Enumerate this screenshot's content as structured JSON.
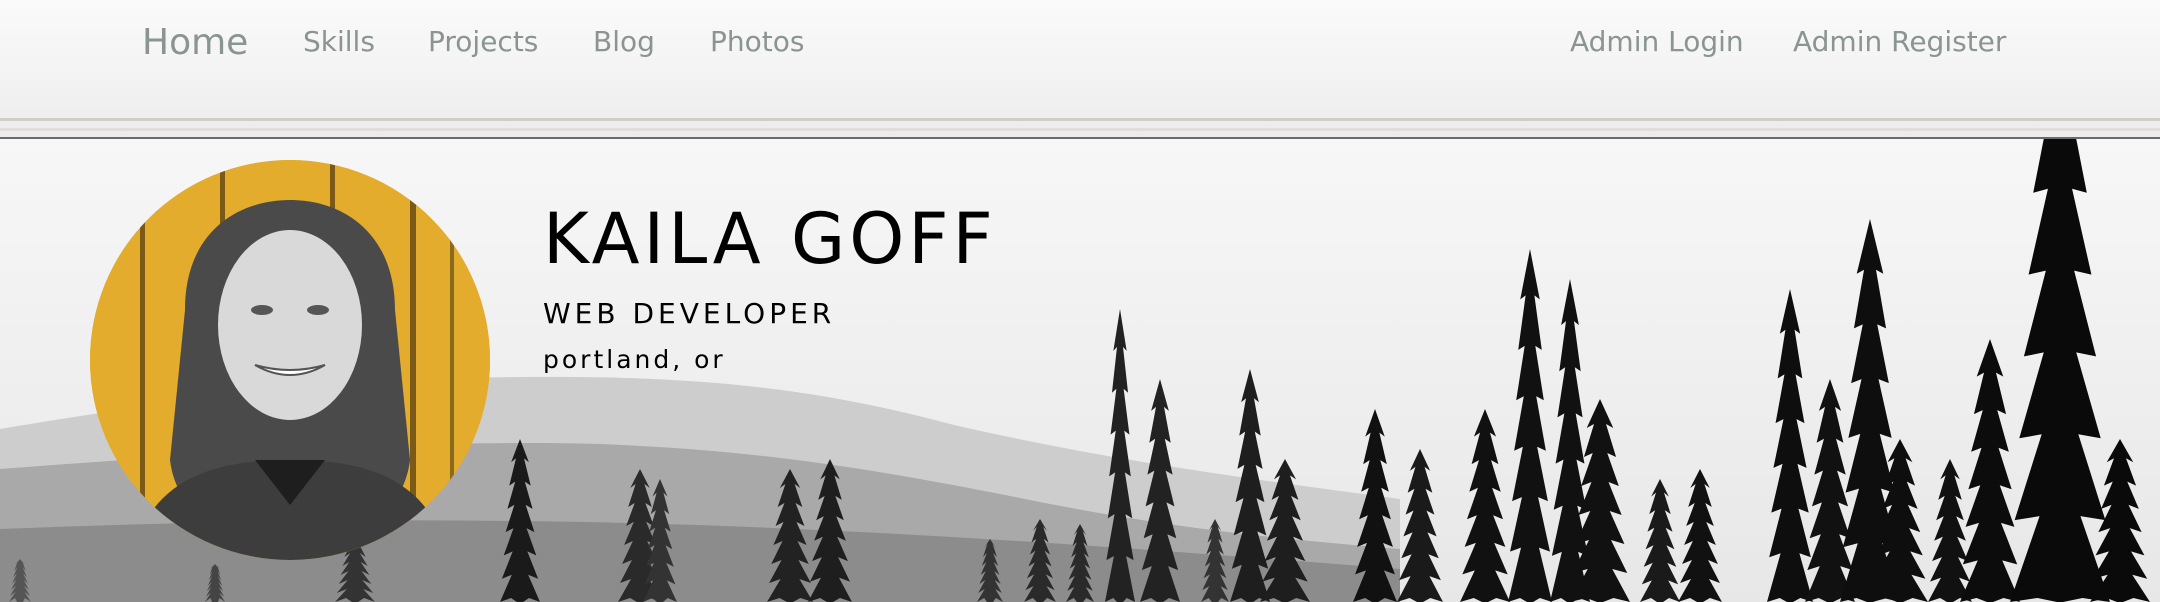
{
  "nav": {
    "home": "Home",
    "skills": "Skills",
    "projects": "Projects",
    "blog": "Blog",
    "photos": "Photos",
    "admin_login": "Admin Login",
    "admin_register": "Admin Register"
  },
  "profile": {
    "name": "KAILA GOFF",
    "title": "WEB DEVELOPER",
    "location": "portland, or",
    "photo_icon": "portrait-photo"
  },
  "colors": {
    "nav_text": "#8a9590",
    "avatar_background": "#e3ac2c",
    "divider": "#6b6b6b"
  }
}
